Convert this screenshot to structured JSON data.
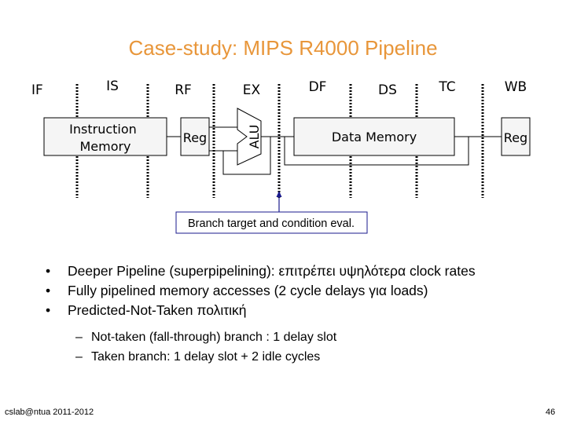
{
  "slide": {
    "title": "Case-study: MIPS R4000 Pipeline",
    "title_color": "#e8963a",
    "page_number": "46",
    "footer": "cslab@ntua 2011-2012"
  },
  "diagram": {
    "stages": [
      "IF",
      "IS",
      "RF",
      "EX",
      "DF",
      "DS",
      "TC",
      "WB"
    ],
    "instruction_memory": [
      "Instruction",
      "Memory"
    ],
    "reg_rf": "Reg",
    "alu": "ALU",
    "data_memory": "Data Memory",
    "reg_wb": "Reg",
    "branch_label": "Branch target and condition eval.",
    "branch_color": "#1a1a8c"
  },
  "bullets": [
    "Deeper Pipeline (superpipelining): επιτρέπει υψηλότερα clock rates",
    "Fully pipelined memory accesses (2 cycle delays για loads)",
    "Predicted-Not-Taken πολιτική"
  ],
  "bullet_glyph": "•",
  "sub_bullets": [
    "Not-taken (fall-through) branch : 1 delay slot",
    "Taken branch: 1 delay slot + 2 idle cycles"
  ],
  "sub_glyph": "–"
}
